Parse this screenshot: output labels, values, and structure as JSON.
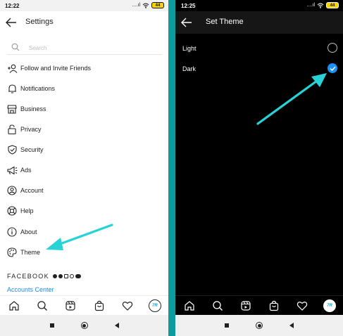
{
  "left": {
    "status_time": "12:22",
    "battery": "44",
    "header_title": "Settings",
    "search_placeholder": "Search",
    "menu": [
      {
        "label": "Follow and Invite Friends",
        "icon": "add-person-icon"
      },
      {
        "label": "Notifications",
        "icon": "bell-icon"
      },
      {
        "label": "Business",
        "icon": "storefront-icon"
      },
      {
        "label": "Privacy",
        "icon": "lock-icon"
      },
      {
        "label": "Security",
        "icon": "shield-check-icon"
      },
      {
        "label": "Ads",
        "icon": "megaphone-icon"
      },
      {
        "label": "Account",
        "icon": "person-circle-icon"
      },
      {
        "label": "Help",
        "icon": "lifebuoy-icon"
      },
      {
        "label": "About",
        "icon": "info-icon"
      },
      {
        "label": "Theme",
        "icon": "palette-icon"
      }
    ],
    "facebook_label": "FACEBOOK",
    "accounts_center": "Accounts Center",
    "avatar_text": "7R"
  },
  "right": {
    "status_time": "12:25",
    "battery": "44",
    "header_title": "Set Theme",
    "options": [
      {
        "label": "Light",
        "selected": false
      },
      {
        "label": "Dark",
        "selected": true
      }
    ],
    "avatar_text": "7R"
  },
  "colors": {
    "accent_teal": "#0e9b9b",
    "annotation_arrow": "#27d3d6",
    "radio_selected": "#1e8ff2",
    "link_blue": "#1b8be0"
  }
}
